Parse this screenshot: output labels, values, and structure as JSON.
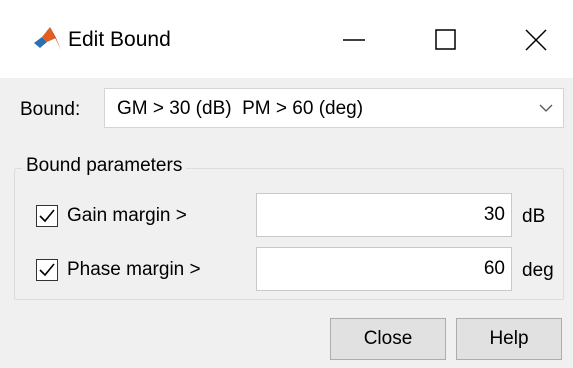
{
  "window": {
    "title": "Edit Bound",
    "app_icon": "matlab-logo-icon",
    "controls": {
      "minimize_icon": "minimize-icon",
      "maximize_icon": "maximize-icon",
      "close_icon": "close-icon"
    }
  },
  "bound": {
    "label": "Bound:",
    "selected": "GM > 30 (dB)  PM > 60 (deg)",
    "dropdown_icon": "chevron-down-icon"
  },
  "parameters": {
    "group_title": "Bound parameters",
    "gain": {
      "checked": true,
      "label": "Gain margin >",
      "value": "30",
      "unit": "dB"
    },
    "phase": {
      "checked": true,
      "label": "Phase margin >",
      "value": "60",
      "unit": "deg"
    }
  },
  "buttons": {
    "close": "Close",
    "help": "Help"
  },
  "colors": {
    "dialog_bg": "#f0f0f0",
    "titlebar_bg": "#ffffff",
    "button_bg": "#e1e1e1",
    "matlab_orange": "#d9541a",
    "matlab_blue": "#2d6fb3"
  }
}
